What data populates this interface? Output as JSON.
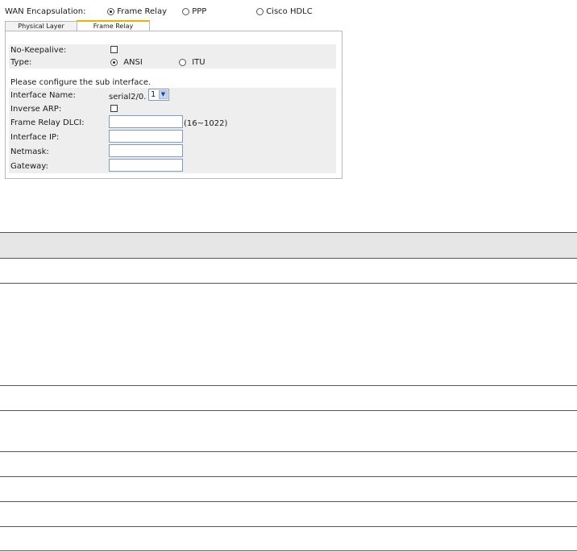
{
  "wan": {
    "label": "WAN Encapsulation:",
    "options": [
      "Frame Relay",
      "PPP",
      "Cisco HDLC"
    ],
    "selected": "Frame Relay"
  },
  "tabs": [
    "Physical Layer",
    "Frame Relay"
  ],
  "active_tab": "Frame Relay",
  "frame_relay": {
    "no_keepalive_label": "No-Keepalive:",
    "no_keepalive_checked": false,
    "type_label": "Type:",
    "type_options": [
      "ANSI",
      "ITU"
    ],
    "type_selected": "ANSI",
    "sub_interface_note": "Please configure the sub interface.",
    "interface_name_label": "Interface Name:",
    "interface_prefix": "serial2/0.",
    "interface_number": "1",
    "inverse_arp_label": "Inverse ARP:",
    "inverse_arp_checked": false,
    "dlci_label": "Frame Relay DLCI:",
    "dlci_value": "",
    "dlci_range": "(16~1022)",
    "ip_label": "Interface IP:",
    "ip_value": "",
    "netmask_label": "Netmask:",
    "netmask_value": "",
    "gateway_label": "Gateway:",
    "gateway_value": ""
  }
}
